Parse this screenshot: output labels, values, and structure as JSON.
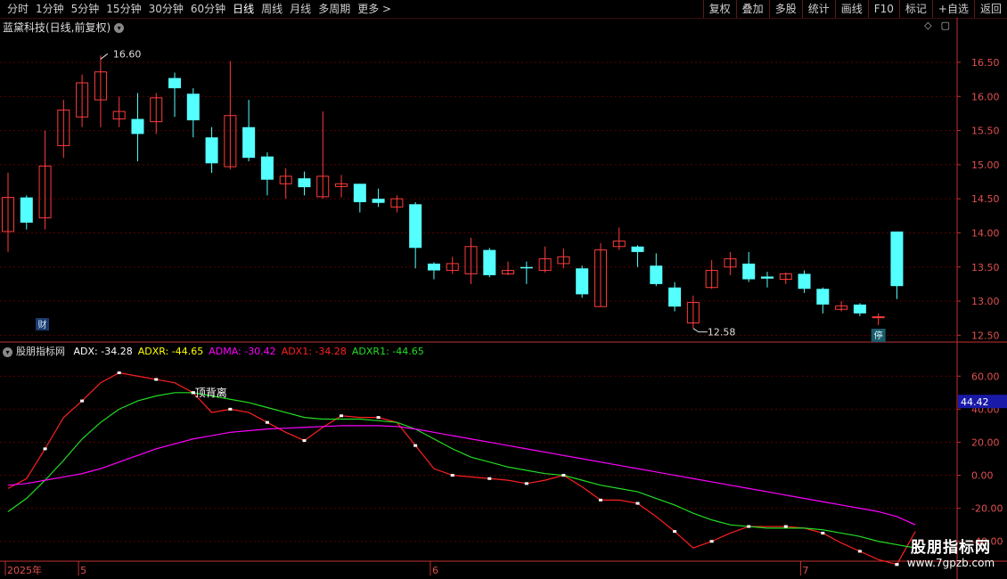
{
  "toolbar": {
    "left": [
      "分时",
      "1分钟",
      "5分钟",
      "15分钟",
      "30分钟",
      "60分钟",
      "日线",
      "周线",
      "月线",
      "多周期",
      "更多 >"
    ],
    "active": "日线",
    "right": [
      "复权",
      "叠加",
      "多股",
      "统计",
      "画线",
      "F10",
      "标记",
      "+自选",
      "返回"
    ]
  },
  "stock": {
    "title": "蓝黛科技(日线,前复权)"
  },
  "price_axis": {
    "ticks": [
      "16.50",
      "16.00",
      "15.50",
      "15.00",
      "14.50",
      "14.00",
      "13.50",
      "13.00",
      "12.50"
    ]
  },
  "annotations": {
    "high_label": "16.60",
    "low_label": "12.58",
    "cai_badge": "财",
    "ting_badge": "停",
    "divergence_label": "顶背离"
  },
  "indicator": {
    "name": "股朋指标网",
    "items": [
      {
        "text": "ADX: -34.28",
        "color": "#ffffff"
      },
      {
        "text": "ADXR: -44.65",
        "color": "#ffff00"
      },
      {
        "text": "ADMA: -30.42",
        "color": "#ff00ff"
      },
      {
        "text": "ADX1: -34.28",
        "color": "#ff2020"
      },
      {
        "text": "ADXR1: -44.65",
        "color": "#22dd22"
      }
    ],
    "axis_ticks": [
      "60.00",
      "40.00",
      "20.00",
      "0.00",
      "-20.00",
      "-40.00"
    ],
    "current_value": "44.42"
  },
  "date_axis": {
    "labels": [
      "2025年",
      "5",
      "6",
      "7"
    ]
  },
  "watermark": {
    "name": "股朋指标网",
    "url": "www.7gpzb.com"
  },
  "colors": {
    "up": "#ff3b3b",
    "down": "#54ffff",
    "grid": "#5a0000",
    "axis": "#c03030"
  },
  "chart_data": [
    {
      "type": "candlestick",
      "ylim": [
        12.4,
        16.8
      ],
      "candles": [
        {
          "o": 14.02,
          "h": 14.88,
          "l": 13.72,
          "c": 14.52
        },
        {
          "o": 14.52,
          "h": 14.55,
          "l": 14.05,
          "c": 14.15
        },
        {
          "o": 14.22,
          "h": 15.5,
          "l": 14.05,
          "c": 14.98
        },
        {
          "o": 15.28,
          "h": 15.95,
          "l": 15.1,
          "c": 15.8
        },
        {
          "o": 15.7,
          "h": 16.32,
          "l": 15.55,
          "c": 16.2
        },
        {
          "o": 15.95,
          "h": 16.6,
          "l": 15.55,
          "c": 16.36
        },
        {
          "o": 15.67,
          "h": 16.0,
          "l": 15.55,
          "c": 15.78
        },
        {
          "o": 15.67,
          "h": 16.05,
          "l": 15.05,
          "c": 15.45
        },
        {
          "o": 15.63,
          "h": 16.05,
          "l": 15.45,
          "c": 15.98
        },
        {
          "o": 16.27,
          "h": 16.35,
          "l": 15.7,
          "c": 16.12
        },
        {
          "o": 16.04,
          "h": 16.12,
          "l": 15.4,
          "c": 15.65
        },
        {
          "o": 15.4,
          "h": 15.55,
          "l": 14.88,
          "c": 15.02
        },
        {
          "o": 14.97,
          "h": 16.52,
          "l": 14.93,
          "c": 15.72
        },
        {
          "o": 15.55,
          "h": 15.95,
          "l": 15.05,
          "c": 15.1
        },
        {
          "o": 15.12,
          "h": 15.18,
          "l": 14.55,
          "c": 14.78
        },
        {
          "o": 14.72,
          "h": 14.95,
          "l": 14.5,
          "c": 14.83
        },
        {
          "o": 14.8,
          "h": 14.9,
          "l": 14.55,
          "c": 14.67
        },
        {
          "o": 14.53,
          "h": 15.78,
          "l": 14.5,
          "c": 14.83
        },
        {
          "o": 14.68,
          "h": 14.85,
          "l": 14.52,
          "c": 14.72
        },
        {
          "o": 14.72,
          "h": 14.72,
          "l": 14.3,
          "c": 14.45
        },
        {
          "o": 14.5,
          "h": 14.65,
          "l": 14.38,
          "c": 14.44
        },
        {
          "o": 14.38,
          "h": 14.55,
          "l": 14.3,
          "c": 14.5
        },
        {
          "o": 14.42,
          "h": 14.45,
          "l": 13.48,
          "c": 13.78
        },
        {
          "o": 13.55,
          "h": 13.57,
          "l": 13.32,
          "c": 13.45
        },
        {
          "o": 13.45,
          "h": 13.65,
          "l": 13.4,
          "c": 13.55
        },
        {
          "o": 13.4,
          "h": 13.93,
          "l": 13.25,
          "c": 13.8
        },
        {
          "o": 13.75,
          "h": 13.78,
          "l": 13.35,
          "c": 13.38
        },
        {
          "o": 13.4,
          "h": 13.58,
          "l": 13.38,
          "c": 13.45
        },
        {
          "o": 13.5,
          "h": 13.58,
          "l": 13.25,
          "c": 13.48
        },
        {
          "o": 13.45,
          "h": 13.8,
          "l": 13.42,
          "c": 13.62
        },
        {
          "o": 13.55,
          "h": 13.77,
          "l": 13.48,
          "c": 13.65
        },
        {
          "o": 13.48,
          "h": 13.52,
          "l": 13.05,
          "c": 13.1
        },
        {
          "o": 12.92,
          "h": 13.85,
          "l": 12.92,
          "c": 13.75
        },
        {
          "o": 13.8,
          "h": 14.08,
          "l": 13.75,
          "c": 13.88
        },
        {
          "o": 13.8,
          "h": 13.82,
          "l": 13.5,
          "c": 13.72
        },
        {
          "o": 13.52,
          "h": 13.7,
          "l": 13.22,
          "c": 13.25
        },
        {
          "o": 13.2,
          "h": 13.28,
          "l": 12.85,
          "c": 12.92
        },
        {
          "o": 12.68,
          "h": 13.08,
          "l": 12.6,
          "c": 12.98
        },
        {
          "o": 13.2,
          "h": 13.6,
          "l": 13.18,
          "c": 13.45
        },
        {
          "o": 13.5,
          "h": 13.72,
          "l": 13.38,
          "c": 13.62
        },
        {
          "o": 13.55,
          "h": 13.72,
          "l": 13.28,
          "c": 13.32
        },
        {
          "o": 13.36,
          "h": 13.43,
          "l": 13.2,
          "c": 13.33
        },
        {
          "o": 13.32,
          "h": 13.42,
          "l": 13.25,
          "c": 13.4
        },
        {
          "o": 13.4,
          "h": 13.45,
          "l": 13.12,
          "c": 13.18
        },
        {
          "o": 13.18,
          "h": 13.2,
          "l": 12.82,
          "c": 12.95
        },
        {
          "o": 12.88,
          "h": 13.0,
          "l": 12.85,
          "c": 12.93
        },
        {
          "o": 12.95,
          "h": 12.97,
          "l": 12.78,
          "c": 12.82
        },
        {
          "o": 12.77,
          "h": 12.82,
          "l": 12.65,
          "c": 12.77
        },
        {
          "o": 14.02,
          "h": 14.02,
          "l": 13.03,
          "c": 13.22
        }
      ]
    },
    {
      "type": "line",
      "ylim": [
        -52,
        72
      ],
      "series": [
        {
          "name": "ADX1",
          "color": "#ff2020",
          "values": [
            -8,
            -2,
            16,
            35,
            45,
            56,
            62,
            60,
            58,
            56,
            50,
            38,
            40,
            38,
            32,
            26,
            21,
            29,
            36,
            35,
            35,
            32,
            18,
            4,
            0,
            -1,
            -2,
            -3,
            -5,
            -3,
            0,
            -7,
            -15,
            -15,
            -17,
            -25,
            -34,
            -44,
            -40,
            -35,
            -31,
            -31,
            -31,
            -32,
            -35,
            -41,
            -46,
            -51,
            -54,
            -34
          ]
        },
        {
          "name": "ADXR1",
          "color": "#22dd22",
          "values": [
            -22,
            -14,
            -3,
            9,
            22,
            32,
            40,
            45,
            48,
            50,
            50,
            48,
            46,
            44,
            41,
            38,
            35,
            34,
            34,
            34,
            33,
            32,
            28,
            22,
            16,
            11,
            8,
            5,
            3,
            1,
            0,
            -3,
            -6,
            -8,
            -10,
            -14,
            -18,
            -23,
            -27,
            -30,
            -31,
            -32,
            -32,
            -32,
            -33,
            -35,
            -37,
            -40,
            -42,
            -44
          ]
        },
        {
          "name": "ADMA",
          "color": "#ff00ff",
          "values": [
            -6,
            -5,
            -3,
            -1,
            1,
            4,
            8,
            12,
            16,
            19,
            22,
            24,
            26,
            27,
            28,
            28.5,
            29,
            29.5,
            30,
            30,
            30,
            29.5,
            28,
            26,
            24,
            22,
            20,
            18,
            16,
            14,
            12,
            10,
            8,
            6,
            4,
            2,
            0,
            -2,
            -4,
            -6,
            -8,
            -10,
            -12,
            -14,
            -16,
            -18,
            -20,
            -22,
            -25,
            -30
          ]
        }
      ]
    }
  ]
}
